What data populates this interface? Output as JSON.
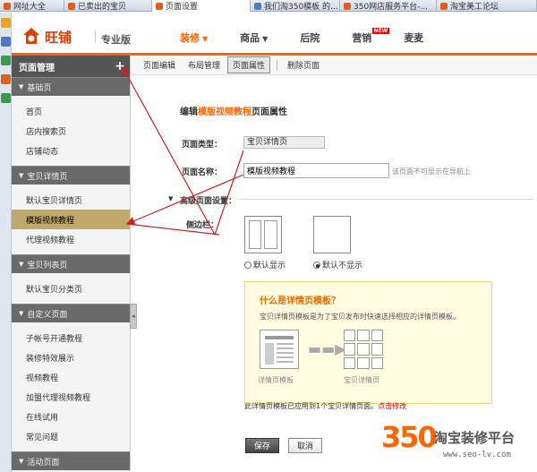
{
  "browser_tabs": [
    {
      "label": "网址大全",
      "color": "#e55b1f",
      "active": false
    },
    {
      "label": "已卖出的宝贝",
      "color": "#e55b1f",
      "active": false
    },
    {
      "label": "页面设置",
      "color": "#e55b1f",
      "active": true
    },
    {
      "label": "我们淘350模板 的...",
      "color": "#4a7ac8",
      "active": false
    },
    {
      "label": "350网店服务平台-...",
      "color": "#e55b1f",
      "active": false
    },
    {
      "label": "淘宝美工论坛",
      "color": "#e55b1f",
      "active": false
    }
  ],
  "header": {
    "logo": "旺铺",
    "edition": "专业版",
    "nav": [
      {
        "label": "装修",
        "caret": "▼",
        "active": true
      },
      {
        "label": "商品",
        "caret": "▼",
        "active": false
      },
      {
        "label": "后院",
        "caret": "",
        "active": false
      },
      {
        "label": "营销",
        "caret": "",
        "badge": "NEW",
        "active": false
      },
      {
        "label": "麦麦",
        "caret": "",
        "active": false
      }
    ]
  },
  "sidebar": {
    "title": "页面管理",
    "add": "+",
    "groups": [
      {
        "label": "基础页",
        "items": [
          "首页",
          "店内搜索页",
          "店铺动态"
        ]
      },
      {
        "label": "宝贝详情页",
        "items": [
          "默认宝贝详情页",
          "模版视频教程",
          "代理视频教程"
        ]
      },
      {
        "label": "宝贝列表页",
        "items": [
          "默认宝贝分类页"
        ]
      },
      {
        "label": "自定义页面",
        "items": [
          "子帐号开通教程",
          "装修特效展示",
          "视频教程",
          "加盟代理视频教程",
          "在线试用",
          "常见问题"
        ]
      },
      {
        "label": "活动页面",
        "items": []
      }
    ],
    "selected": "模版视频教程"
  },
  "subbar": {
    "buttons": [
      "页面编辑",
      "布局管理",
      "页面属性"
    ],
    "active": "页面属性",
    "delete": "删除页面"
  },
  "form": {
    "title_prefix": "编辑",
    "title_highlight": "模版视频教程",
    "title_suffix": "页面属性",
    "type_label": "页面类型：",
    "type_value": "宝贝详情页",
    "name_label": "页面名称：",
    "name_value": "模版视频教程",
    "name_hint": "该页面不可显示在导航上",
    "advanced_label": "高级页面设置：",
    "sidebar_label": "侧边栏：",
    "radio_default": "默认显示",
    "radio_hide": "默认不显示"
  },
  "info": {
    "title": "什么是详情页模板？",
    "desc": "宝贝详情页模板是为了宝贝发布时快速选择相应的详情页模板。",
    "cap_left": "详情页模板",
    "cap_right": "宝贝详情页"
  },
  "applied": {
    "text": "此详情页模板已应用到1个宝贝详情页面。",
    "link": "点击修改"
  },
  "buttons": {
    "save": "保存",
    "cancel": "取消"
  },
  "watermark": {
    "num": "350",
    "text": "淘宝装修平台",
    "url": "www.seo-lv.com"
  },
  "colors": {
    "accent": "#ff6600",
    "annotation": "#cc2222"
  }
}
